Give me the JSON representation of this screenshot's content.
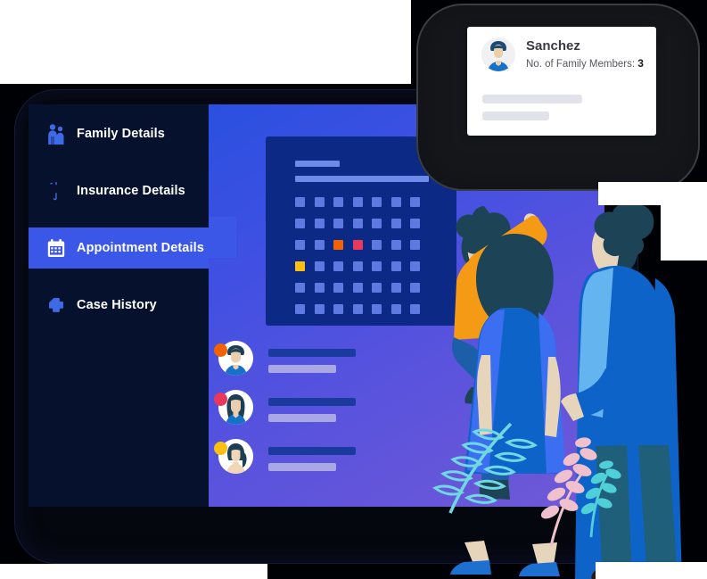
{
  "app": {
    "title": "Appointment Details",
    "colors": {
      "sidebar_bg": "#06112e",
      "accent_blue": "#3b57e8",
      "content_gradient_start": "#2a50e0",
      "content_gradient_end": "#7059d6",
      "calendar_card_bg": "#0c2a85",
      "calendar_cell": "#5c7ae0",
      "highlight_orange": "#f26200",
      "highlight_pink": "#e8385c",
      "highlight_yellow": "#f9c011"
    }
  },
  "sidebar": {
    "items": [
      {
        "label": "Family Details",
        "icon": "family-icon",
        "active": false
      },
      {
        "label": "Insurance Details",
        "icon": "umbrella-icon",
        "active": false
      },
      {
        "label": "Appointment Details",
        "icon": "calendar-icon",
        "active": true
      },
      {
        "label": "Case History",
        "icon": "medical-cross-icon",
        "active": false
      }
    ]
  },
  "calendar": {
    "title_placeholder": "",
    "subtitle_placeholder": "",
    "columns": 7,
    "rows": 6,
    "cells": [
      [
        "default",
        "default",
        "default",
        "default",
        "default",
        "default",
        "default"
      ],
      [
        "default",
        "default",
        "default",
        "default",
        "default",
        "default",
        "default"
      ],
      [
        "default",
        "default",
        "orange",
        "pink",
        "default",
        "default",
        "default"
      ],
      [
        "yellow",
        "default",
        "default",
        "default",
        "default",
        "default",
        "default"
      ],
      [
        "default",
        "default",
        "default",
        "default",
        "default",
        "default",
        "default"
      ],
      [
        "default",
        "default",
        "default",
        "default",
        "default",
        "default",
        "default"
      ]
    ]
  },
  "appointment_list": [
    {
      "badge": "orange",
      "avatar": "avatar-man",
      "primary_placeholder": "",
      "secondary_placeholder": ""
    },
    {
      "badge": "pink",
      "avatar": "avatar-woman",
      "primary_placeholder": "",
      "secondary_placeholder": ""
    },
    {
      "badge": "yellow",
      "avatar": "avatar-girl",
      "primary_placeholder": "",
      "secondary_placeholder": ""
    }
  ],
  "popup": {
    "name": "Sanchez",
    "family_members_label": "No. of Family Members:",
    "family_members_count": "3",
    "avatar": "avatar-man"
  }
}
